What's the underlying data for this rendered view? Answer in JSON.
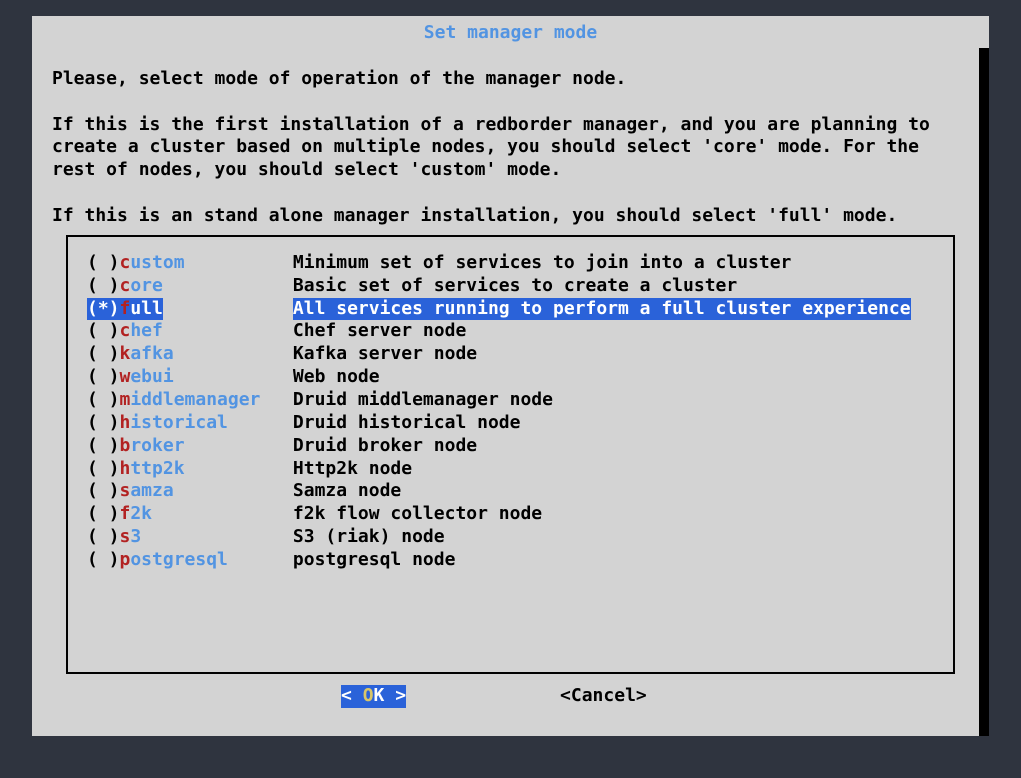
{
  "title": "Set manager mode",
  "intro": "Please, select mode of operation of the manager node.\n\nIf this is the first installation of a redborder manager, and you are planning to\ncreate a cluster based on multiple nodes, you should select 'core' mode. For the\nrest of nodes, you should select 'custom' mode.\n\nIf this is an stand alone manager installation, you should select 'full' mode.",
  "options": [
    {
      "hotkey": "c",
      "name": "ustom",
      "desc": "Minimum set of services to join into a cluster",
      "selected": false
    },
    {
      "hotkey": "c",
      "name": "ore",
      "desc": "Basic set of services to create a cluster",
      "selected": false
    },
    {
      "hotkey": "f",
      "name": "ull",
      "desc": "All services running to perform a full cluster experience",
      "selected": true
    },
    {
      "hotkey": "c",
      "name": "hef",
      "desc": "Chef server node",
      "selected": false
    },
    {
      "hotkey": "k",
      "name": "afka",
      "desc": "Kafka server node",
      "selected": false
    },
    {
      "hotkey": "w",
      "name": "ebui",
      "desc": "Web node",
      "selected": false
    },
    {
      "hotkey": "m",
      "name": "iddlemanager",
      "desc": "Druid middlemanager node",
      "selected": false
    },
    {
      "hotkey": "h",
      "name": "istorical",
      "desc": "Druid historical node",
      "selected": false
    },
    {
      "hotkey": "b",
      "name": "roker",
      "desc": "Druid broker node",
      "selected": false
    },
    {
      "hotkey": "h",
      "name": "ttp2k",
      "desc": "Http2k node",
      "selected": false
    },
    {
      "hotkey": "s",
      "name": "amza",
      "desc": "Samza node",
      "selected": false
    },
    {
      "hotkey": "f",
      "name": "2k",
      "desc": "f2k flow collector node",
      "selected": false
    },
    {
      "hotkey": "s",
      "name": "3",
      "desc": "S3 (riak) node",
      "selected": false
    },
    {
      "hotkey": "p",
      "name": "ostgresql",
      "desc": "postgresql node",
      "selected": false
    }
  ],
  "buttons": {
    "ok": {
      "prefix": "<  ",
      "hotkey": "O",
      "rest": "K  >"
    },
    "cancel": "<Cancel>"
  }
}
